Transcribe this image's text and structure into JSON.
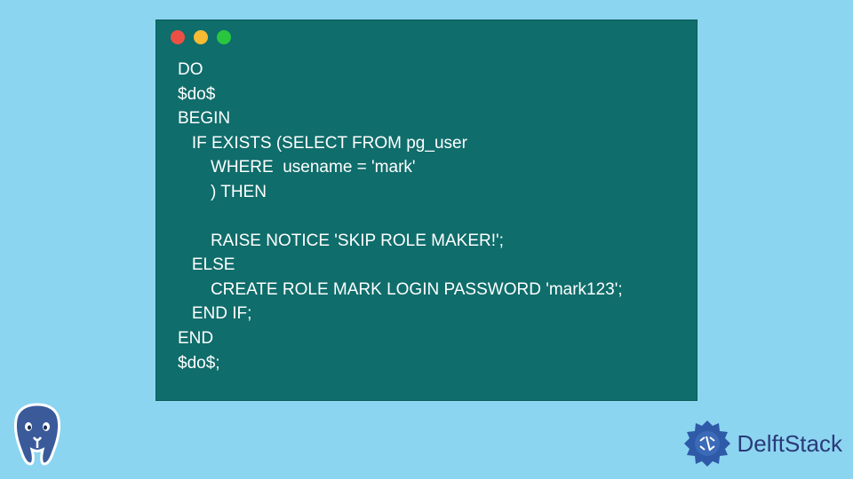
{
  "code": {
    "line1": "DO",
    "line2": "$do$",
    "line3": "BEGIN",
    "line4": "   IF EXISTS (SELECT FROM pg_user",
    "line5": "       WHERE  usename = 'mark'",
    "line6": "       ) THEN",
    "line7": "",
    "line8": "       RAISE NOTICE 'SKIP ROLE MAKER!';",
    "line9": "   ELSE",
    "line10": "       CREATE ROLE MARK LOGIN PASSWORD 'mark123';",
    "line11": "   END IF;",
    "line12": "END",
    "line13": "$do$;"
  },
  "brand": {
    "name": "DelftStack"
  }
}
